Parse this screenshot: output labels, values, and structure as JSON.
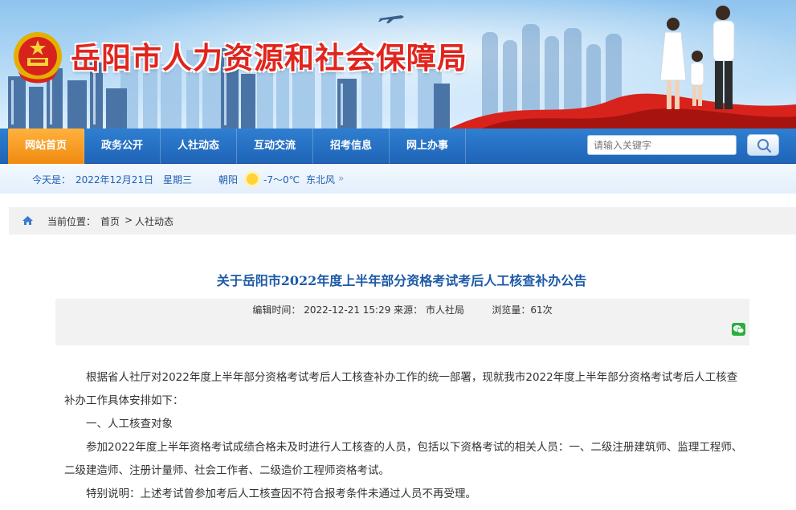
{
  "header": {
    "site_title": "岳阳市人力资源和社会保障局"
  },
  "nav": {
    "items": [
      {
        "label": "网站首页",
        "active": true
      },
      {
        "label": "政务公开",
        "active": false
      },
      {
        "label": "人社动态",
        "active": false
      },
      {
        "label": "互动交流",
        "active": false
      },
      {
        "label": "招考信息",
        "active": false
      },
      {
        "label": "网上办事",
        "active": false
      }
    ],
    "search_placeholder": "请输入关键字"
  },
  "infobar": {
    "today_label": "今天是：",
    "date": "2022年12月21日",
    "weekday": "星期三",
    "city": "朝阳",
    "temperature": "-7～0℃",
    "wind": "东北风"
  },
  "breadcrumb": {
    "label": "当前位置：",
    "home": "首页",
    "separator": ">",
    "section": "人社动态"
  },
  "article": {
    "title": "关于岳阳市2022年度上半年部分资格考试考后人工核查补办公告",
    "meta_line": "编辑时间： 2022-12-21 15:29 来源： 市人社局         浏览量：61次",
    "paragraphs": [
      "根据省人社厅对2022年度上半年部分资格考试考后人工核查补办工作的统一部署，现就我市2022年度上半年部分资格考试考后人工核查补办工作具体安排如下：",
      "一、人工核查对象",
      "参加2022年度上半年资格考试成绩合格未及时进行人工核查的人员，包括以下资格考试的相关人员：一、二级注册建筑师、监理工程师、二级建造师、注册计量师、社会工作者、二级造价工程师资格考试。",
      "特别说明：上述考试曾参加考后人工核查因不符合报考条件未通过人员不再受理。"
    ]
  },
  "colors": {
    "nav_blue": "#1f64b7",
    "nav_active_orange": "#f08a10",
    "title_red": "#e0251e",
    "article_title_blue": "#1c5aa6"
  }
}
